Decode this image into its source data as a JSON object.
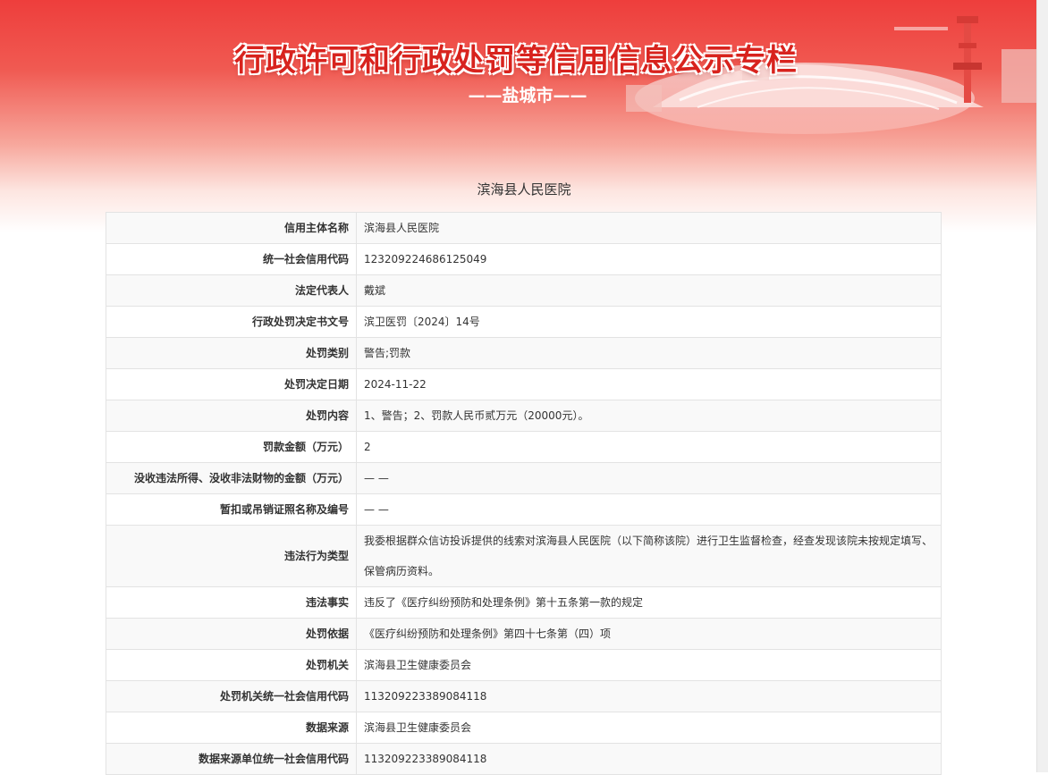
{
  "header": {
    "title": "行政许可和行政处罚等信用信息公示专栏",
    "subtitle": "——盐城市——"
  },
  "entity_title": "滨海县人民医院",
  "rows": [
    {
      "label": "信用主体名称",
      "value": "滨海县人民医院"
    },
    {
      "label": "统一社会信用代码",
      "value": "123209224686125049"
    },
    {
      "label": "法定代表人",
      "value": "戴斌"
    },
    {
      "label": "行政处罚决定书文号",
      "value": "滨卫医罚〔2024〕14号"
    },
    {
      "label": "处罚类别",
      "value": "警告;罚款"
    },
    {
      "label": "处罚决定日期",
      "value": "2024-11-22"
    },
    {
      "label": "处罚内容",
      "value": "1、警告；2、罚款人民币贰万元（20000元）。"
    },
    {
      "label": "罚款金额（万元）",
      "value": "2"
    },
    {
      "label": "没收违法所得、没收非法财物的金额（万元）",
      "value": "— —"
    },
    {
      "label": "暂扣或吊销证照名称及编号",
      "value": "— —"
    },
    {
      "label": "违法行为类型",
      "value": "我委根据群众信访投诉提供的线索对滨海县人民医院（以下简称该院）进行卫生监督检查，经查发现该院未按规定填写、保管病历资料。"
    },
    {
      "label": "违法事实",
      "value": "违反了《医疗纠纷预防和处理条例》第十五条第一款的规定"
    },
    {
      "label": "处罚依据",
      "value": "《医疗纠纷预防和处理条例》第四十七条第（四）项"
    },
    {
      "label": "处罚机关",
      "value": "滨海县卫生健康委员会"
    },
    {
      "label": "处罚机关统一社会信用代码",
      "value": "11320922338908411 8"
    },
    {
      "label": "数据来源",
      "value": "滨海县卫生健康委员会"
    },
    {
      "label": "数据来源单位统一社会信用代码",
      "value": "113209223389084118"
    }
  ]
}
